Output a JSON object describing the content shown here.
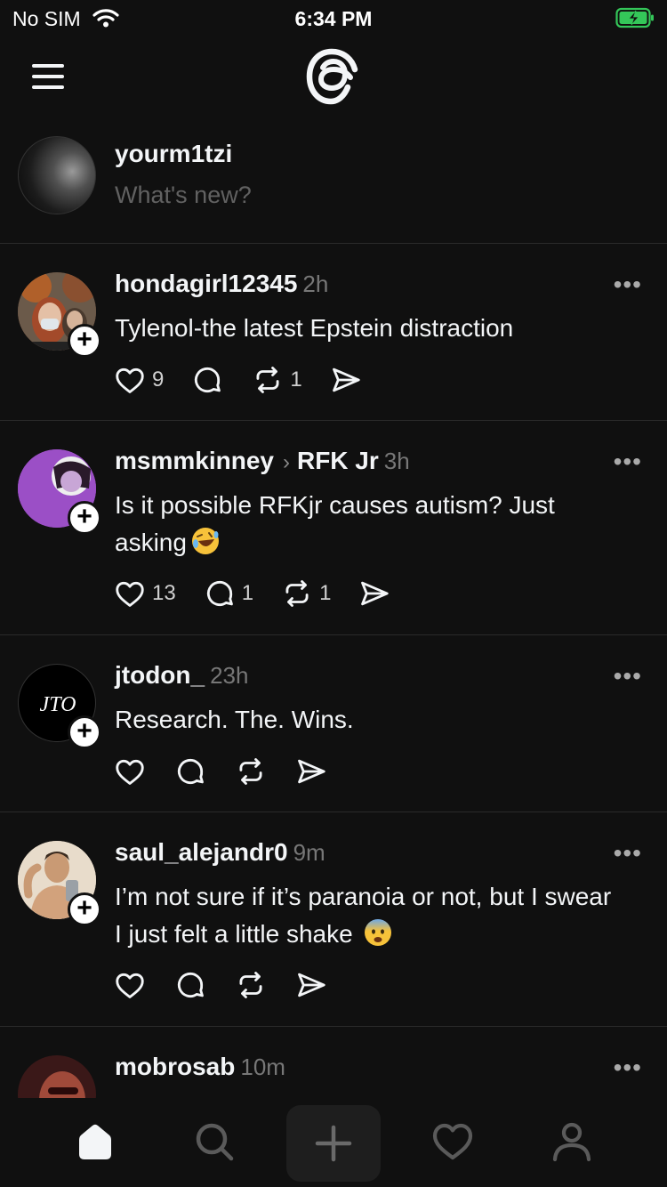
{
  "status_bar": {
    "carrier": "No SIM",
    "time": "6:34 PM"
  },
  "composer": {
    "username": "yourm1tzi",
    "placeholder": "What's new?"
  },
  "posts": [
    {
      "user": "hondagirl12345",
      "topic": "",
      "time": "2h",
      "text": "Tylenol-the latest Epstein distraction",
      "likes": "9",
      "replies": "",
      "reposts": "1",
      "avatar_color": "#8a5a3a"
    },
    {
      "user": "msmmkinney",
      "topic": "RFK Jr",
      "time": "3h",
      "text": "Is it possible RFKjr causes autism? Just asking",
      "likes": "13",
      "replies": "1",
      "reposts": "1",
      "emoji": "rolling-on-floor-laughing",
      "avatar_color": "#9b4fc6"
    },
    {
      "user": "jtodon_",
      "topic": "",
      "time": "23h",
      "text": "Research. The. Wins.",
      "likes": "",
      "replies": "",
      "reposts": "",
      "avatar_monogram": "JTO",
      "avatar_color": "#000000"
    },
    {
      "user": "saul_alejandr0",
      "topic": "",
      "time": "9m",
      "text": "I’m not sure if it’s paranoia or not, but I swear I just felt a little shake",
      "likes": "",
      "replies": "",
      "reposts": "",
      "emoji": "fearful-face",
      "avatar_color": "#d9b89a"
    },
    {
      "user": "mobrosab",
      "topic": "",
      "time": "10m",
      "text": "",
      "avatar_color": "#7a3a3a"
    }
  ],
  "more_label": "•••",
  "follow_label": "+",
  "icons": {
    "like": "heart-icon",
    "reply": "comment-icon",
    "repost": "repost-icon",
    "share": "send-icon",
    "menu": "menu-icon",
    "logo": "threads-logo-icon",
    "tabs": [
      "home-icon",
      "search-icon",
      "create-icon",
      "activity-heart-icon",
      "profile-icon"
    ]
  },
  "colors": {
    "background": "#101010",
    "text": "#f3f5f7",
    "muted": "#777777",
    "divider": "#2a2a2a",
    "battery": "#34c759"
  }
}
